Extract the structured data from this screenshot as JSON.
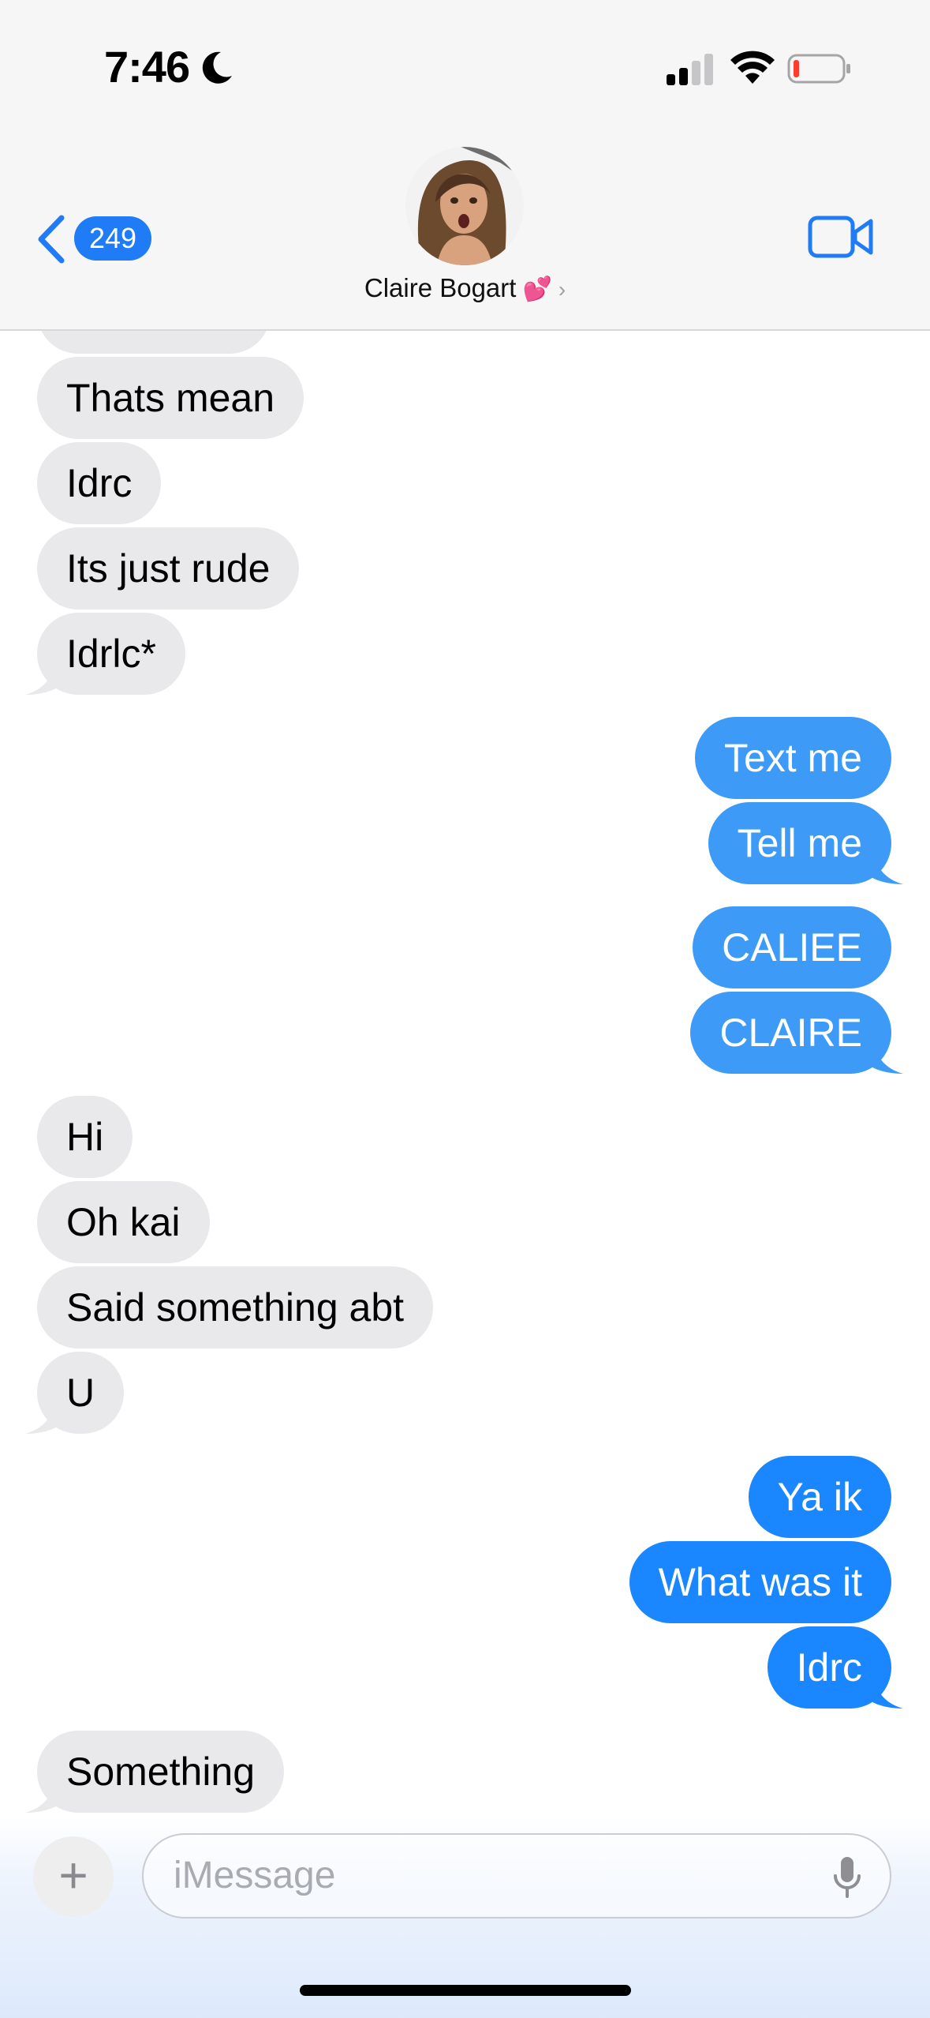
{
  "status_bar": {
    "time": "7:46"
  },
  "header": {
    "back_count": "249",
    "contact_name": "Claire Bogart",
    "contact_emoji": "💕",
    "chevron": "›"
  },
  "messages": [
    {
      "from": "them",
      "text": "Thats mean"
    },
    {
      "from": "them",
      "text": "Idrc"
    },
    {
      "from": "them",
      "text": "Its just rude"
    },
    {
      "from": "them",
      "text": "Idrlc*"
    },
    {
      "from": "me",
      "text": "Text me"
    },
    {
      "from": "me",
      "text": "Tell me"
    },
    {
      "from": "me",
      "text": "CALIEE"
    },
    {
      "from": "me",
      "text": "CLAIRE"
    },
    {
      "from": "them",
      "text": "Hi"
    },
    {
      "from": "them",
      "text": "Oh kai"
    },
    {
      "from": "them",
      "text": "Said something abt"
    },
    {
      "from": "them",
      "text": "U"
    },
    {
      "from": "me",
      "text": "Ya ik"
    },
    {
      "from": "me",
      "text": "What was it"
    },
    {
      "from": "me",
      "text": "Idrc"
    },
    {
      "from": "them",
      "text": "Something"
    }
  ],
  "composer": {
    "placeholder": "iMessage",
    "plus": "+"
  },
  "icons": [
    "moon-icon",
    "signal-icon",
    "wifi-icon",
    "battery-icon",
    "back-chevron-icon",
    "video-camera-icon",
    "plus-icon",
    "microphone-icon"
  ],
  "colors": {
    "incoming": "#e9e9eb",
    "outgoing": "#1a86ff",
    "accent": "#1f7bf6"
  }
}
